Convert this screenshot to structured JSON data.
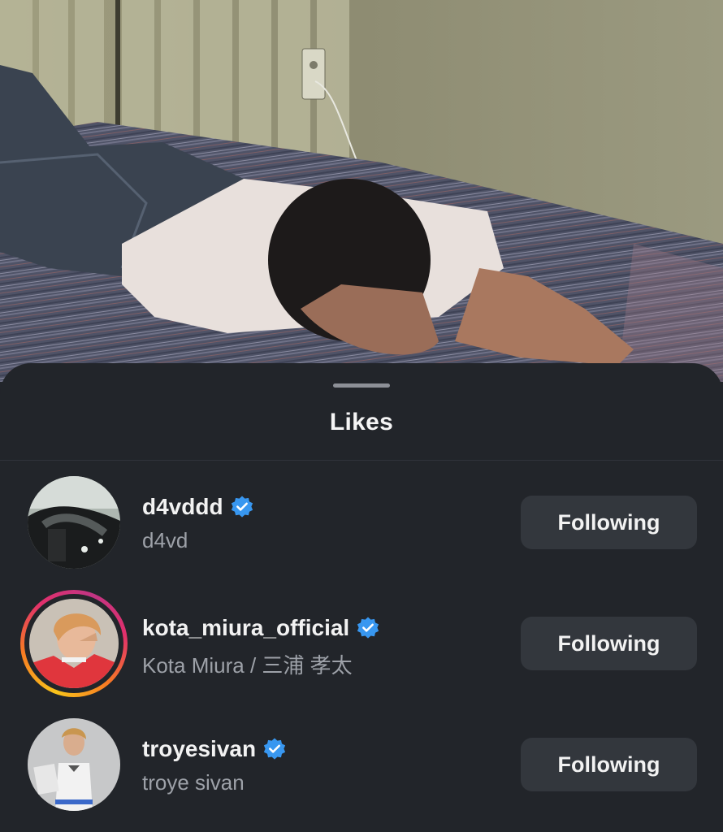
{
  "sheet": {
    "title": "Likes"
  },
  "likes": [
    {
      "username": "d4vddd",
      "full_name": "d4vd",
      "verified": true,
      "has_story": false,
      "button_label": "Following"
    },
    {
      "username": "kota_miura_official",
      "full_name": "Kota Miura / 三浦 孝太",
      "verified": true,
      "has_story": true,
      "button_label": "Following"
    },
    {
      "username": "troyesivan",
      "full_name": "troye sivan",
      "verified": true,
      "has_story": false,
      "button_label": "Following"
    }
  ],
  "colors": {
    "sheet_background": "#22252a",
    "verified_badge": "#3897f0",
    "button_background": "#33373d",
    "secondary_text": "#9da1a8"
  },
  "icons": {
    "verified": "verified-badge-icon"
  }
}
